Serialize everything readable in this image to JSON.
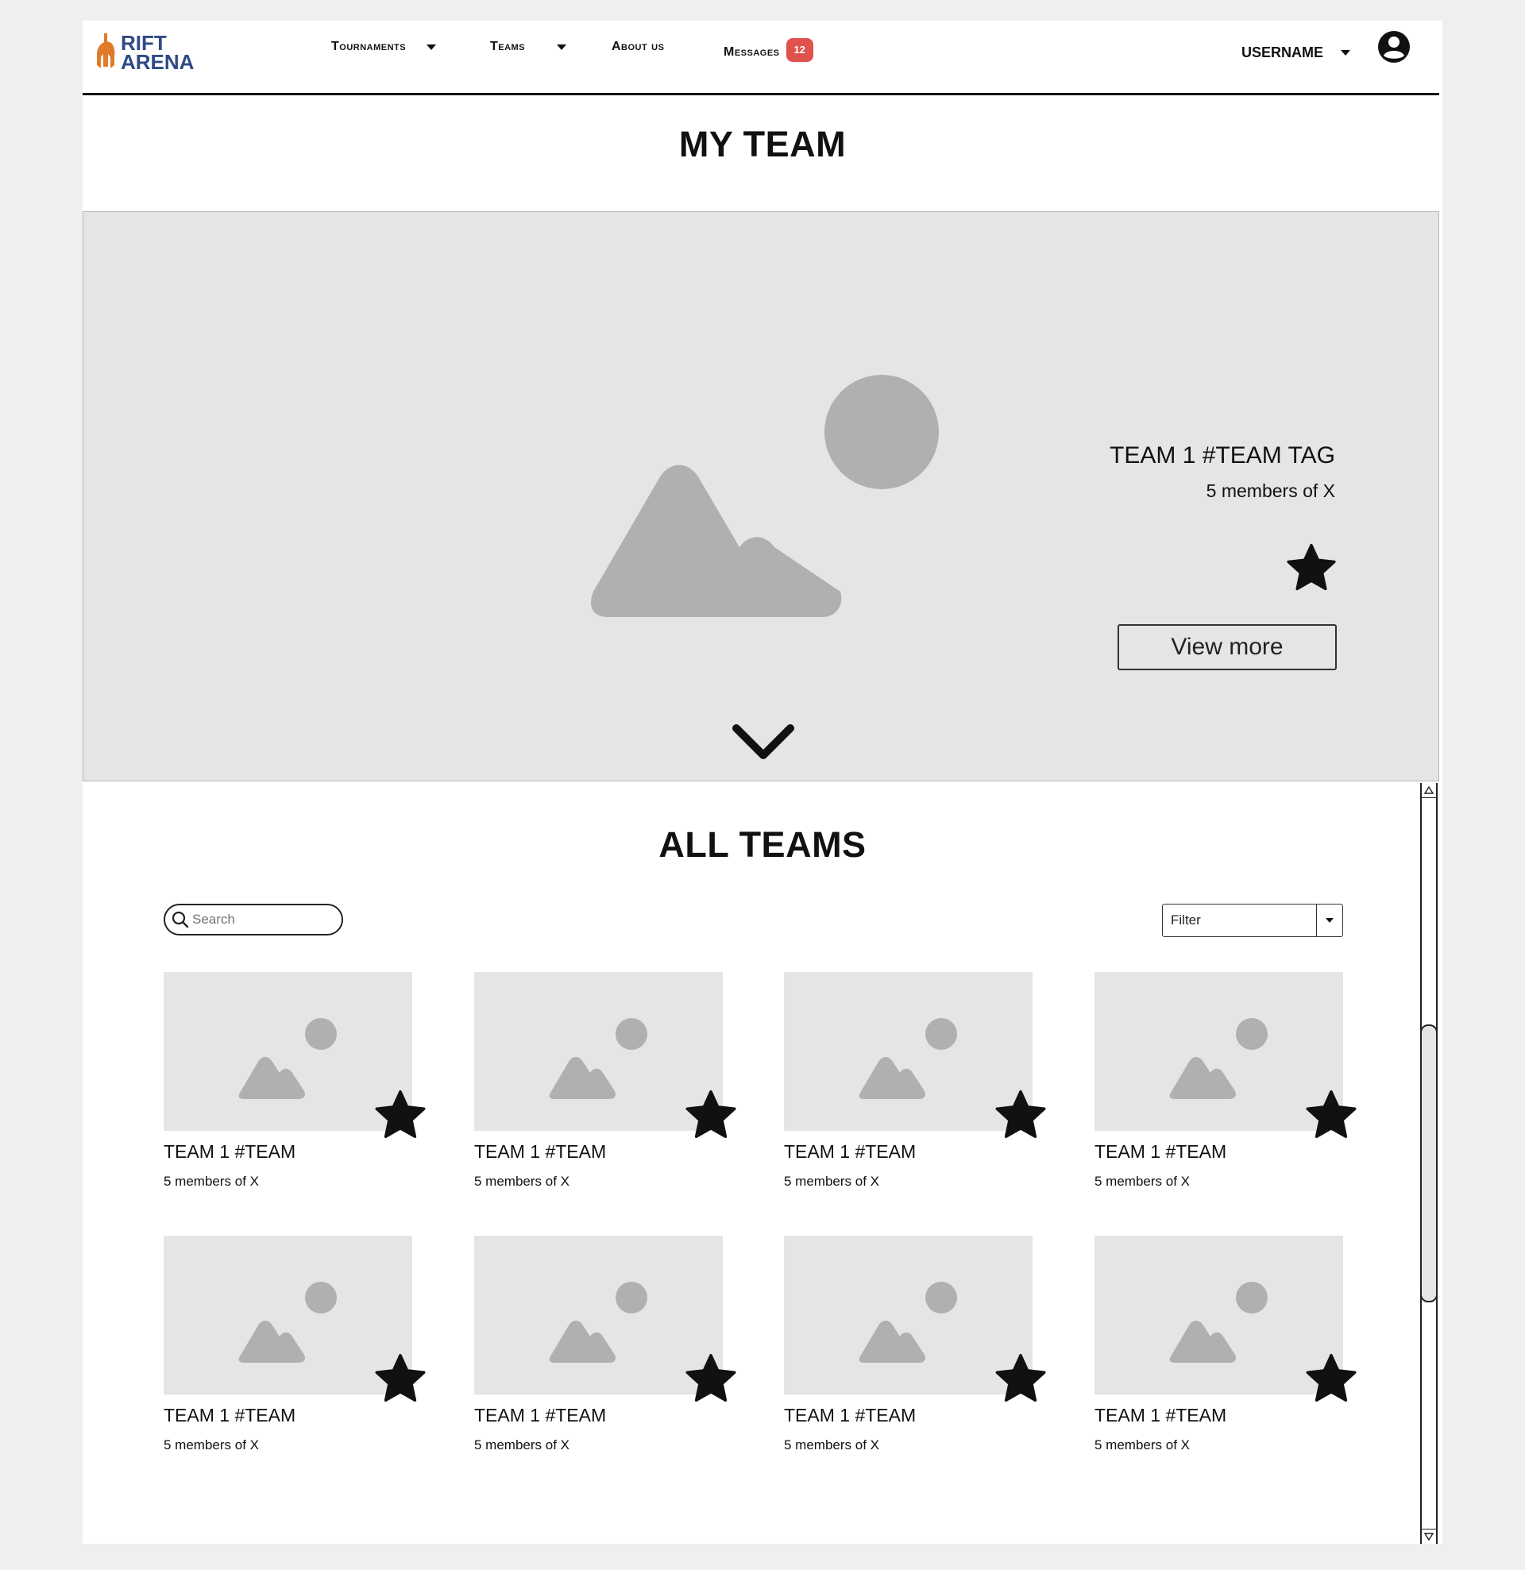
{
  "header": {
    "logo": {
      "line1": "RIFT",
      "line2": "ARENA"
    },
    "nav": [
      {
        "id": "tournaments",
        "label": "Tournaments",
        "has_caret": true
      },
      {
        "id": "teams",
        "label": "Teams",
        "has_caret": true
      },
      {
        "id": "about",
        "label": "About us",
        "has_caret": false
      },
      {
        "id": "messages",
        "label": "Messages",
        "badge": "12"
      }
    ],
    "username": "USERNAME",
    "badge_color": "#e0524c",
    "logo_colors": {
      "icon": "#e07b2a",
      "text": "#2e4a86"
    }
  },
  "my_team": {
    "heading": "MY TEAM",
    "team_title": "TEAM 1 #TEAM TAG",
    "members": "5 members of X",
    "favorite": true,
    "view_more_label": "View more",
    "icons": {
      "image": "image-placeholder-icon",
      "star": "star-icon",
      "expand": "chevron-down-icon"
    }
  },
  "all_teams": {
    "heading": "ALL TEAMS",
    "search_placeholder": "Search",
    "filter_value": "Filter",
    "cards": [
      {
        "title": "TEAM 1 #TEAM",
        "members": "5 members of X",
        "favorite": true
      },
      {
        "title": "TEAM 1 #TEAM",
        "members": "5 members of X",
        "favorite": true
      },
      {
        "title": "TEAM 1 #TEAM",
        "members": "5 members of X",
        "favorite": true
      },
      {
        "title": "TEAM 1 #TEAM",
        "members": "5 members of X",
        "favorite": true
      },
      {
        "title": "TEAM 1 #TEAM",
        "members": "5 members of X",
        "favorite": true
      },
      {
        "title": "TEAM 1 #TEAM",
        "members": "5 members of X",
        "favorite": true
      },
      {
        "title": "TEAM 1 #TEAM",
        "members": "5 members of X",
        "favorite": true
      },
      {
        "title": "TEAM 1 #TEAM",
        "members": "5 members of X",
        "favorite": true
      }
    ]
  }
}
